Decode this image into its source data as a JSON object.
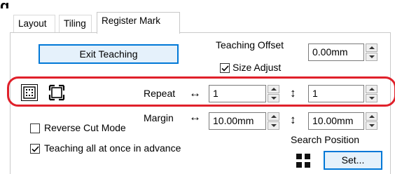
{
  "tabs": [
    {
      "label": "Layout"
    },
    {
      "label": "Tiling"
    },
    {
      "label": "Register Mark",
      "active": true
    }
  ],
  "buttons": {
    "exit_teaching": "Exit Teaching",
    "set": "Set..."
  },
  "teaching_offset": {
    "label": "Teaching Offset",
    "value": "0.00mm"
  },
  "size_adjust": {
    "label": "Size Adjust",
    "checked": true
  },
  "repeat": {
    "label": "Repeat",
    "horizontal_symbol": "↔",
    "vertical_symbol": "↕",
    "horizontal_value": "1",
    "vertical_value": "1"
  },
  "margin": {
    "label": "Margin",
    "horizontal_symbol": "↔",
    "vertical_symbol": "↕",
    "horizontal_value": "10.00mm",
    "vertical_value": "10.00mm"
  },
  "reverse_cut_mode": {
    "label": "Reverse Cut Mode",
    "checked": false
  },
  "teaching_all_at_once": {
    "label": "Teaching all at once in advance",
    "checked": true
  },
  "search_position": {
    "label": "Search Position"
  },
  "icons": [
    "grid-dots-icon",
    "corner-marks-icon",
    "four-squares-icon"
  ],
  "colors": {
    "highlight_ring": "#e0202a",
    "focus_border": "#0078d7"
  }
}
